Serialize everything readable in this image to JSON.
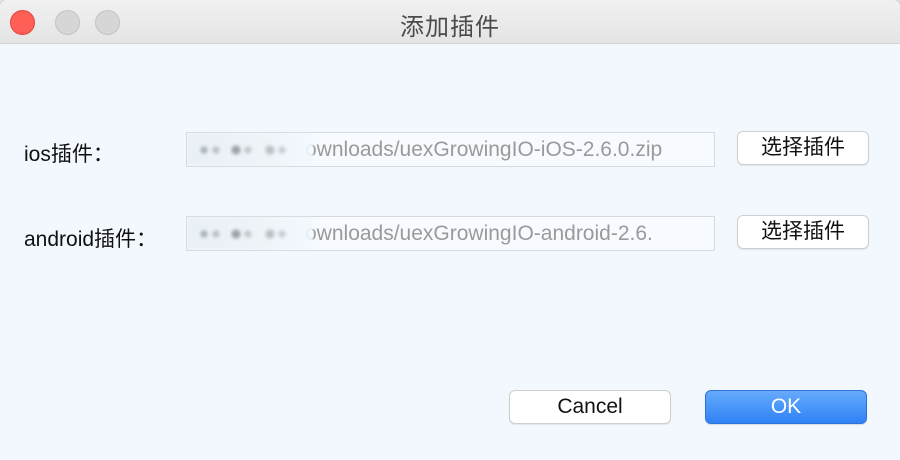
{
  "window": {
    "title": "添加插件",
    "close_color": "#ff5f57",
    "inactive_control_color": "#d6d6d6",
    "background_color": "#f2f8fe"
  },
  "ios": {
    "label": "ios插件：",
    "path_visible": "ownloads/uexGrowingIO-iOS-2.6.0.zip",
    "select_button": "选择插件"
  },
  "android": {
    "label": "android插件：",
    "path_visible": "ownloads/uexGrowingIO-android-2.6.",
    "select_button": "选择插件"
  },
  "actions": {
    "cancel": "Cancel",
    "ok": "OK",
    "primary_color": "#2f82f6"
  },
  "icons": {
    "close": "close-window-icon",
    "minimize": "minimize-window-icon",
    "zoom": "zoom-window-icon"
  }
}
